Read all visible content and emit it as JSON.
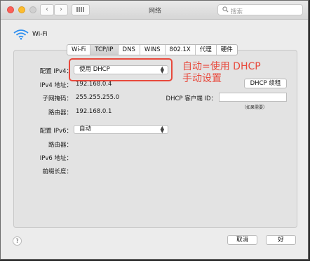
{
  "window": {
    "title": "网络"
  },
  "search": {
    "placeholder": "搜索"
  },
  "wifi": {
    "name": "Wi-Fi"
  },
  "tabs": [
    {
      "label": "Wi-Fi"
    },
    {
      "label": "TCP/IP"
    },
    {
      "label": "DNS"
    },
    {
      "label": "WINS"
    },
    {
      "label": "802.1X"
    },
    {
      "label": "代理"
    },
    {
      "label": "硬件"
    }
  ],
  "ipv4": {
    "config_label": "配置 IPv4：",
    "config_value": "使用 DHCP",
    "address_label": "IPv4 地址：",
    "address_value": "192.168.0.4",
    "subnet_label": "子网掩码：",
    "subnet_value": "255.255.255.0",
    "router_label": "路由器：",
    "router_value": "192.168.0.1",
    "renew_button": "DHCP 续租",
    "client_id_label": "DHCP 客户端 ID：",
    "client_id_value": "",
    "client_id_hint": "（如果需要）"
  },
  "ipv6": {
    "config_label": "配置 IPv6：",
    "config_value": "自动",
    "router_label": "路由器：",
    "address_label": "IPv6 地址：",
    "prefix_label": "前缀长度："
  },
  "annotation": {
    "line1": "自动=使用 DHCP",
    "line2": "手动设置",
    "color": "#e8493c"
  },
  "footer": {
    "help": "?",
    "cancel": "取消",
    "ok": "好"
  }
}
